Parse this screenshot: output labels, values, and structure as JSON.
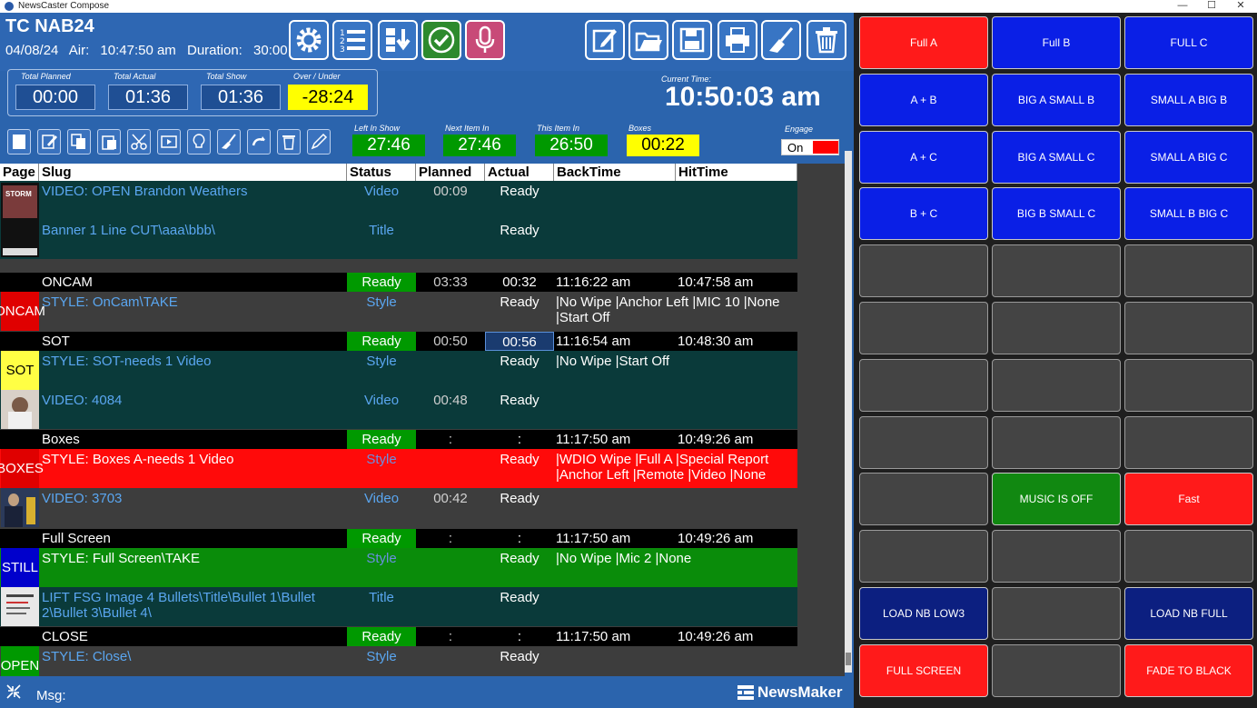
{
  "window": {
    "title": "NewsCaster Compose",
    "controls": [
      "—",
      "☐",
      "✕"
    ]
  },
  "show": {
    "name": "TC NAB24",
    "date": "04/08/24",
    "air_label": "Air:",
    "air_time": "10:47:50 am",
    "duration_label": "Duration:",
    "duration": "30:00"
  },
  "totals": [
    {
      "label": "Total Planned",
      "value": "00:00",
      "highlight": false
    },
    {
      "label": "Total Actual",
      "value": "01:36",
      "highlight": false
    },
    {
      "label": "Total Show",
      "value": "01:36",
      "highlight": false
    },
    {
      "label": "Over / Under",
      "value": "-28:24",
      "highlight": true
    }
  ],
  "current_time": {
    "label": "Current Time:",
    "value": "10:50:03 am"
  },
  "timers": [
    {
      "label": "Left In Show",
      "value": "27:46",
      "highlight": false
    },
    {
      "label": "Next Item In",
      "value": "27:46",
      "highlight": false
    },
    {
      "label": "This Item In",
      "value": "26:50",
      "highlight": false
    },
    {
      "label": "Boxes",
      "value": "00:22",
      "highlight": true
    }
  ],
  "engage": {
    "label": "Engage",
    "value": "On"
  },
  "columns": [
    "Page",
    "Slug",
    "Status",
    "Planned",
    "Actual",
    "BackTime",
    "HitTime"
  ],
  "stories": [
    {
      "slug": "",
      "status": "",
      "planned": "",
      "actual": "",
      "back": "",
      "hit": "",
      "page": "",
      "page_color": "",
      "items": [
        {
          "slug": "VIDEO: OPEN Brandon Weathers",
          "status": "Video",
          "planned": "00:09",
          "actual": "Ready",
          "back": ""
        },
        {
          "slug": "Banner 1 Line CUT\\aaa\\bbb\\",
          "status": "Title",
          "planned": "",
          "actual": "Ready",
          "back": ""
        }
      ]
    },
    {
      "slug": "ONCAM",
      "status": "Ready",
      "planned": "03:33",
      "actual": "00:32",
      "back": "11:16:22 am",
      "hit": "10:47:58 am",
      "page": "ONCAM",
      "page_color": "#e00000",
      "items": [
        {
          "slug": "STYLE: OnCam\\TAKE",
          "status": "Style",
          "planned": "",
          "actual": "Ready",
          "back": "|No Wipe |Anchor Left |MIC 10 |None |Start Off"
        }
      ]
    },
    {
      "slug": "SOT",
      "status": "Ready",
      "planned": "00:50",
      "actual": "00:56",
      "back": "11:16:54 am",
      "hit": "10:48:30 am",
      "page": "SOT",
      "page_color": "#ffff44",
      "items": [
        {
          "slug": "STYLE: SOT-needs 1 Video",
          "status": "Style",
          "planned": "",
          "actual": "Ready",
          "back": "|No Wipe |Start Off"
        },
        {
          "slug": "VIDEO: 4084",
          "status": "Video",
          "planned": "00:48",
          "actual": "Ready",
          "back": ""
        }
      ]
    },
    {
      "slug": "Boxes",
      "status": "Ready",
      "planned": ":",
      "actual": ":",
      "back": "11:17:50 am",
      "hit": "10:49:26 am",
      "page": "BOXES",
      "page_color": "#e00000",
      "items": [
        {
          "slug": "STYLE: Boxes A-needs 1 Video",
          "status": "Style",
          "planned": "",
          "actual": "Ready",
          "back": "|WDIO Wipe |Full A |Special Report |Anchor Left |Remote |Video |None |Start Off"
        },
        {
          "slug": "VIDEO: 3703",
          "status": "Video",
          "planned": "00:42",
          "actual": "Ready",
          "back": ""
        }
      ]
    },
    {
      "slug": "Full Screen",
      "status": "Ready",
      "planned": ":",
      "actual": ":",
      "back": "11:17:50 am",
      "hit": "10:49:26 am",
      "page": "STILL",
      "page_color": "#0000cc",
      "items": [
        {
          "slug": "STYLE: Full Screen\\TAKE",
          "status": "Style",
          "planned": "",
          "actual": "Ready",
          "back": "|No Wipe |Mic 2 |None"
        },
        {
          "slug": "LIFT FSG Image 4 Bullets\\Title\\Bullet 1\\Bullet 2\\Bullet 3\\Bullet 4\\",
          "status": "Title",
          "planned": "",
          "actual": "Ready",
          "back": ""
        }
      ]
    },
    {
      "slug": "CLOSE",
      "status": "Ready",
      "planned": ":",
      "actual": ":",
      "back": "11:17:50 am",
      "hit": "10:49:26 am",
      "page": "OPEN",
      "page_color": "#009900",
      "items": [
        {
          "slug": "STYLE: Close\\",
          "status": "Style",
          "planned": "",
          "actual": "Ready",
          "back": ""
        }
      ]
    }
  ],
  "status_bar": {
    "msg_label": "Msg:",
    "brand": "NewsMaker"
  },
  "panel_buttons": [
    {
      "label": "Full A",
      "color": "#ff1a1a"
    },
    {
      "label": "Full B",
      "color": "#0a1fe6"
    },
    {
      "label": "FULL C",
      "color": "#0a1fe6"
    },
    {
      "label": "A + B",
      "color": "#0a1fe6"
    },
    {
      "label": "BIG A SMALL B",
      "color": "#0a1fe6"
    },
    {
      "label": "SMALL A BIG B",
      "color": "#0a1fe6"
    },
    {
      "label": "A + C",
      "color": "#0a1fe6"
    },
    {
      "label": "BIG A SMALL C",
      "color": "#0a1fe6"
    },
    {
      "label": "SMALL A BIG C",
      "color": "#0a1fe6"
    },
    {
      "label": "B + C",
      "color": "#0a1fe6"
    },
    {
      "label": "BIG B SMALL C",
      "color": "#0a1fe6"
    },
    {
      "label": "SMALL B BIG C",
      "color": "#0a1fe6"
    },
    {
      "label": "",
      "color": "#444444"
    },
    {
      "label": "",
      "color": "#444444"
    },
    {
      "label": "",
      "color": "#444444"
    },
    {
      "label": "",
      "color": "#444444"
    },
    {
      "label": "",
      "color": "#444444"
    },
    {
      "label": "",
      "color": "#444444"
    },
    {
      "label": "",
      "color": "#444444"
    },
    {
      "label": "",
      "color": "#444444"
    },
    {
      "label": "",
      "color": "#444444"
    },
    {
      "label": "",
      "color": "#444444"
    },
    {
      "label": "",
      "color": "#444444"
    },
    {
      "label": "",
      "color": "#444444"
    },
    {
      "label": "",
      "color": "#444444"
    },
    {
      "label": "MUSIC IS OFF",
      "color": "#118811"
    },
    {
      "label": "Fast",
      "color": "#ff1a1a"
    },
    {
      "label": "",
      "color": "#444444"
    },
    {
      "label": "",
      "color": "#444444"
    },
    {
      "label": "",
      "color": "#444444"
    },
    {
      "label": "LOAD NB LOW3",
      "color": "#0c1f80"
    },
    {
      "label": "",
      "color": "#444444"
    },
    {
      "label": "LOAD NB FULL",
      "color": "#0c1f80"
    },
    {
      "label": "FULL SCREEN",
      "color": "#ff1a1a"
    },
    {
      "label": "",
      "color": "#444444"
    },
    {
      "label": "FADE TO BLACK",
      "color": "#ff1a1a"
    }
  ],
  "icons": {
    "toolbar": [
      "gear-icon",
      "numbered-list-icon",
      "import-icon",
      "check-icon",
      "microphone-icon",
      "edit-icon",
      "folder-open-icon",
      "save-icon",
      "print-icon",
      "broom-icon",
      "trash-icon"
    ],
    "row_toolbar": [
      "new-item-icon",
      "edit-item-icon",
      "copy-icon",
      "paste-icon",
      "cut-icon",
      "preview-icon",
      "idea-icon",
      "clean-icon",
      "undo-icon",
      "delete-icon",
      "pen-icon"
    ]
  }
}
